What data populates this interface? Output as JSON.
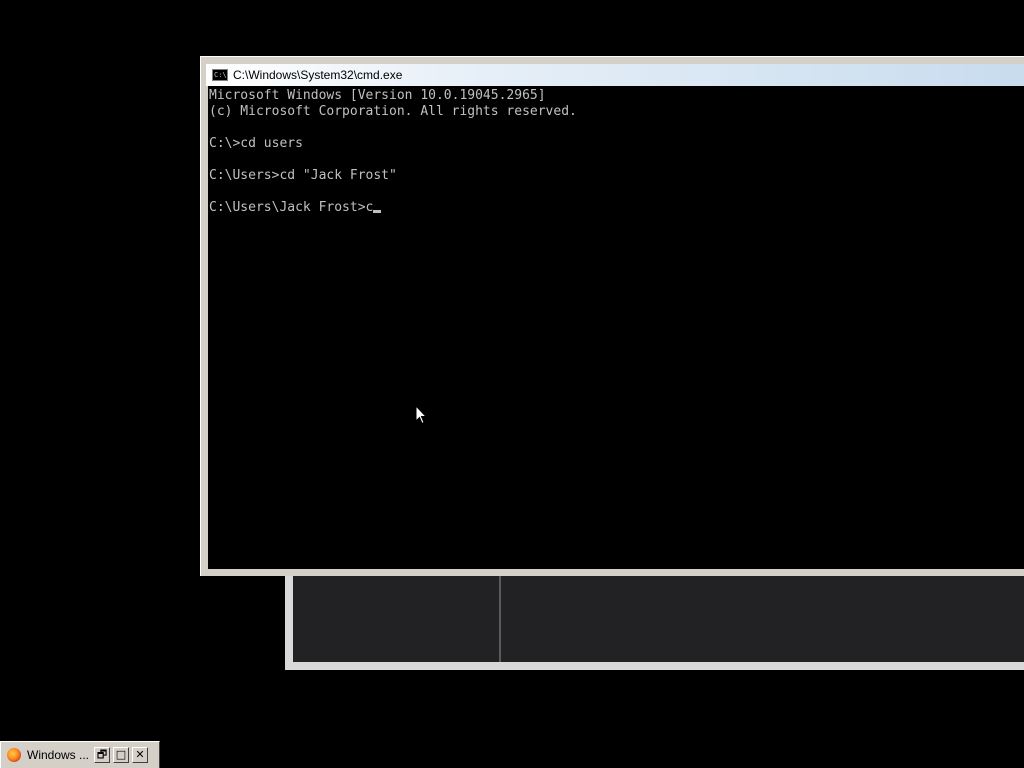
{
  "cmd_window": {
    "title": "C:\\Windows\\System32\\cmd.exe",
    "icon": "cmd-icon",
    "icon_text": "C:\\",
    "lines": [
      "Microsoft Windows [Version 10.0.19045.2965]",
      "(c) Microsoft Corporation. All rights reserved.",
      "",
      "C:\\>cd users",
      "",
      "C:\\Users>cd \"Jack Frost\"",
      "",
      "C:\\Users\\Jack Frost>c"
    ],
    "text_color": "#c0c0c0",
    "background_color": "#000000"
  },
  "minimized_window": {
    "title": "Windows ...",
    "icon": "firefox-icon",
    "restore_symbol": "🗗",
    "maximize_symbol": "□",
    "close_symbol": "✕"
  }
}
